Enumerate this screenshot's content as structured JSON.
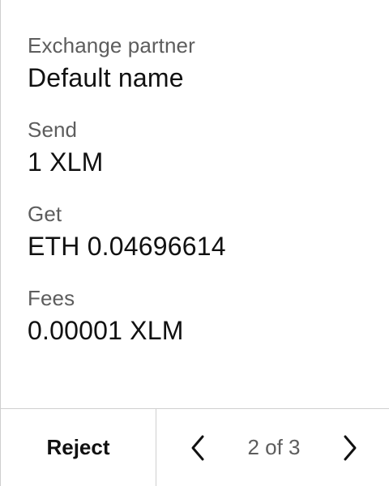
{
  "fields": [
    {
      "label": "Exchange partner",
      "value": "Default name"
    },
    {
      "label": "Send",
      "value": "1 XLM"
    },
    {
      "label": "Get",
      "value": "ETH 0.04696614"
    },
    {
      "label": "Fees",
      "value": "0.00001 XLM"
    }
  ],
  "footer": {
    "reject_label": "Reject",
    "page_indicator": "2 of 3",
    "prev_icon": "chevron-left-icon",
    "next_icon": "chevron-right-icon"
  },
  "colors": {
    "text": "#111111",
    "label": "#5d5d5d",
    "divider": "#cfcfcf",
    "background": "#ffffff"
  }
}
